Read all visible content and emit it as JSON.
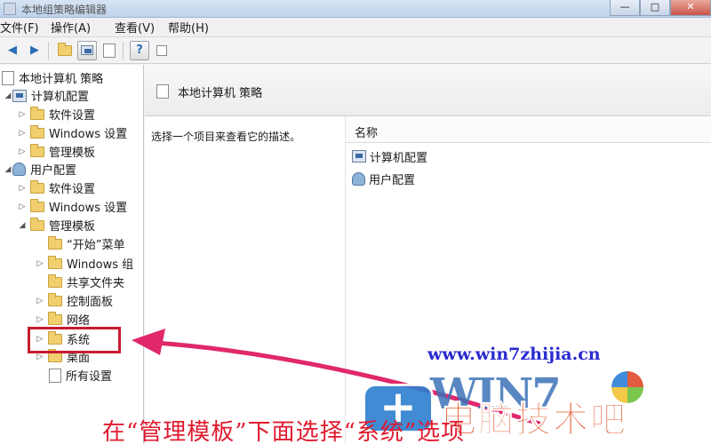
{
  "window": {
    "title": "本地组策略编辑器",
    "controls": [
      "—",
      "□",
      "✕"
    ]
  },
  "menu": [
    "文件(F)",
    "操作(A)",
    "查看(V)",
    "帮助(H)"
  ],
  "toolbar": {
    "back": "◀",
    "forward": "▶",
    "help": "?"
  },
  "tree": {
    "root": "本地计算机 策略",
    "computer_config": {
      "label": "计算机配置",
      "children": [
        "软件设置",
        "Windows 设置",
        "管理模板"
      ]
    },
    "user_config": {
      "label": "用户配置",
      "children": [
        "软件设置",
        "Windows 设置"
      ],
      "admin_templates": {
        "label": "管理模板",
        "children": [
          "“开始”菜单",
          "Windows 组",
          "共享文件夹",
          "控制面板",
          "网络",
          "系统",
          "桌面",
          "所有设置"
        ]
      }
    }
  },
  "right_pane": {
    "header_title": "本地计算机 策略",
    "description": "选择一个项目来查看它的描述。",
    "column_name": "名称",
    "items": [
      "计算机配置",
      "用户配置"
    ]
  },
  "overlay": {
    "url": "www.win7zhijia.cn",
    "logo_text": "WIN7",
    "brand": "电脑技术吧",
    "caption": "在“管理模板”下面选择“系统”选项",
    "highlight_color": "#c61c2e",
    "arrow_color": "#e0286b"
  }
}
